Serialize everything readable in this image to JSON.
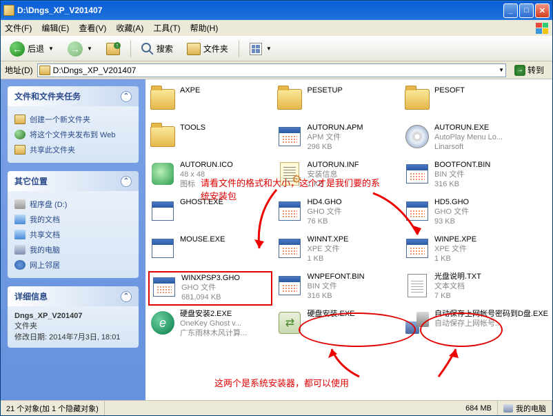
{
  "title": "D:\\Dngs_XP_V201407",
  "menu": {
    "file": "文件(F)",
    "edit": "编辑(E)",
    "view": "查看(V)",
    "fav": "收藏(A)",
    "tools": "工具(T)",
    "help": "帮助(H)"
  },
  "toolbar": {
    "back": "后退",
    "search": "搜索",
    "folders": "文件夹"
  },
  "address": {
    "label": "地址(D)",
    "path": "D:\\Dngs_XP_V201407",
    "go": "转到"
  },
  "sidebar": {
    "tasks": {
      "title": "文件和文件夹任务",
      "newfolder": "创建一个新文件夹",
      "publish": "将这个文件夹发布到 Web",
      "share": "共享此文件夹"
    },
    "other": {
      "title": "其它位置",
      "drive": "程序盘 (D:)",
      "mydocs": "我的文档",
      "shared": "共享文档",
      "mycomp": "我的电脑",
      "network": "网上邻居"
    },
    "details": {
      "title": "详细信息",
      "name": "Dngs_XP_V201407",
      "type": "文件夹",
      "modified": "修改日期: 2014年7月3日, 18:01"
    }
  },
  "files": [
    {
      "name": "AXPE",
      "t": "folder"
    },
    {
      "name": "PESETUP",
      "t": "folder"
    },
    {
      "name": "PESOFT",
      "t": "folder"
    },
    {
      "name": "TOOLS",
      "t": "folder"
    },
    {
      "name": "AUTORUN.APM",
      "line2": "APM 文件",
      "line3": "296 KB",
      "t": "bin"
    },
    {
      "name": "AUTORUN.EXE",
      "line2": "AutoPlay Menu Lo...",
      "line3": "Linarsoft",
      "t": "disk"
    },
    {
      "name": "AUTORUN.ICO",
      "line2": "48 x 48",
      "line3": "图标",
      "t": "ico"
    },
    {
      "name": "AUTORUN.INF",
      "line2": "安装信息",
      "line3": "1 KB",
      "t": "inf"
    },
    {
      "name": "BOOTFONT.BIN",
      "line2": "BIN 文件",
      "line3": "316 KB",
      "t": "bin"
    },
    {
      "name": "GHOST.EXE",
      "line2": "",
      "line3": "",
      "t": "app"
    },
    {
      "name": "HD4.GHO",
      "line2": "GHO 文件",
      "line3": "76 KB",
      "t": "gho"
    },
    {
      "name": "HD5.GHO",
      "line2": "GHO 文件",
      "line3": "93 KB",
      "t": "gho"
    },
    {
      "name": "MOUSE.EXE",
      "line2": "",
      "line3": "",
      "t": "app"
    },
    {
      "name": "WINNT.XPE",
      "line2": "XPE 文件",
      "line3": "1 KB",
      "t": "bin"
    },
    {
      "name": "WINPE.XPE",
      "line2": "XPE 文件",
      "line3": "1 KB",
      "t": "bin"
    },
    {
      "name": "WINXPSP3.GHO",
      "line2": "GHO 文件",
      "line3": "681,094 KB",
      "t": "gho",
      "hl": true
    },
    {
      "name": "WNPEFONT.BIN",
      "line2": "BIN 文件",
      "line3": "316 KB",
      "t": "bin"
    },
    {
      "name": "光盘说明.TXT",
      "line2": "文本文档",
      "line3": "7 KB",
      "t": "txt"
    },
    {
      "name": "硬盘安装2.EXE",
      "line2": "OneKey Ghost v...",
      "line3": "广东雨林木风计算...",
      "t": "inst1"
    },
    {
      "name": "硬盘安装.EXE",
      "line2": "",
      "line3": "",
      "t": "inst2"
    },
    {
      "name": "自动保存上网帐号密码到D盘.EXE",
      "line2": "自动保存上网帐号...",
      "line3": "",
      "t": "savepwd"
    }
  ],
  "annotations": {
    "text1": "请看文件的格式和大小，这个才是我们要的系统安装包",
    "text2": "这两个是系统安装器，都可以使用"
  },
  "status": {
    "objects": "21 个对象(加 1 个隐藏对象)",
    "size": "684 MB",
    "location": "我的电脑"
  }
}
